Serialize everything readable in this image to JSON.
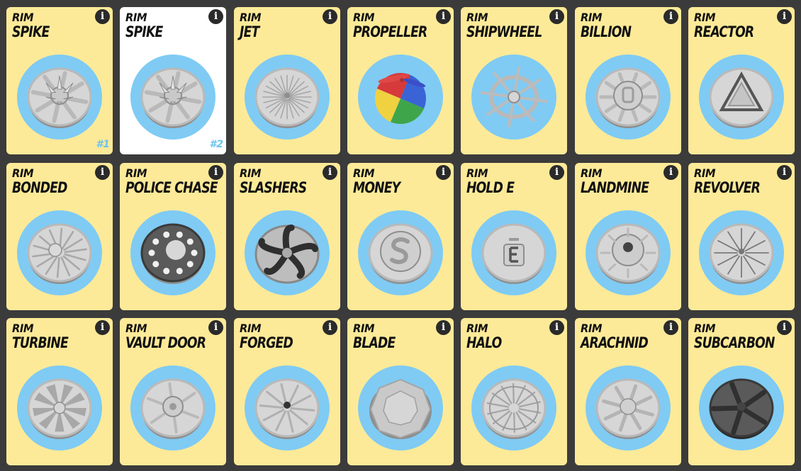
{
  "info_glyph": "i",
  "cards": [
    {
      "type": "RIM",
      "name": "SPIKE",
      "badge": "#1",
      "icon": "spike-rim-icon",
      "style": "spike",
      "selected": false
    },
    {
      "type": "RIM",
      "name": "SPIKE",
      "badge": "#2",
      "icon": "spike-rim-icon",
      "style": "spike",
      "selected": true
    },
    {
      "type": "RIM",
      "name": "JET",
      "badge": "",
      "icon": "jet-rim-icon",
      "style": "jet",
      "selected": false
    },
    {
      "type": "RIM",
      "name": "PROPELLER",
      "badge": "",
      "icon": "propeller-cap-icon",
      "style": "propeller",
      "selected": false
    },
    {
      "type": "RIM",
      "name": "SHIPWHEEL",
      "badge": "",
      "icon": "shipwheel-rim-icon",
      "style": "shipwheel",
      "selected": false
    },
    {
      "type": "RIM",
      "name": "BILLION",
      "badge": "",
      "icon": "billion-rim-icon",
      "style": "billion",
      "selected": false
    },
    {
      "type": "RIM",
      "name": "REACTOR",
      "badge": "",
      "icon": "reactor-rim-icon",
      "style": "reactor",
      "selected": false
    },
    {
      "type": "RIM",
      "name": "BONDED",
      "badge": "",
      "icon": "bonded-rim-icon",
      "style": "bonded",
      "selected": false
    },
    {
      "type": "RIM",
      "name": "POLICE CHASE",
      "badge": "",
      "icon": "police-chase-rim-icon",
      "style": "police",
      "selected": false
    },
    {
      "type": "RIM",
      "name": "SLASHERS",
      "badge": "",
      "icon": "slashers-rim-icon",
      "style": "slashers",
      "selected": false
    },
    {
      "type": "RIM",
      "name": "MONEY",
      "badge": "",
      "icon": "money-rim-icon",
      "style": "money",
      "selected": false
    },
    {
      "type": "RIM",
      "name": "HOLD E",
      "badge": "",
      "icon": "hold-e-rim-icon",
      "style": "holde",
      "selected": false
    },
    {
      "type": "RIM",
      "name": "LANDMINE",
      "badge": "",
      "icon": "landmine-rim-icon",
      "style": "landmine",
      "selected": false
    },
    {
      "type": "RIM",
      "name": "REVOLVER",
      "badge": "",
      "icon": "revolver-rim-icon",
      "style": "revolver",
      "selected": false
    },
    {
      "type": "RIM",
      "name": "TURBINE",
      "badge": "",
      "icon": "turbine-rim-icon",
      "style": "turbine",
      "selected": false
    },
    {
      "type": "RIM",
      "name": "VAULT DOOR",
      "badge": "",
      "icon": "vault-door-rim-icon",
      "style": "vault",
      "selected": false
    },
    {
      "type": "RIM",
      "name": "FORGED",
      "badge": "",
      "icon": "forged-rim-icon",
      "style": "forged",
      "selected": false
    },
    {
      "type": "RIM",
      "name": "BLADE",
      "badge": "",
      "icon": "blade-rim-icon",
      "style": "blade",
      "selected": false
    },
    {
      "type": "RIM",
      "name": "HALO",
      "badge": "",
      "icon": "halo-rim-icon",
      "style": "halo",
      "selected": false
    },
    {
      "type": "RIM",
      "name": "ARACHNID",
      "badge": "",
      "icon": "arachnid-rim-icon",
      "style": "arachnid",
      "selected": false
    },
    {
      "type": "RIM",
      "name": "SUBCARBON",
      "badge": "",
      "icon": "subcarbon-rim-icon",
      "style": "subcarbon",
      "selected": false
    }
  ],
  "colors": {
    "card": "#fdea98",
    "card_selected": "#ffffff",
    "circle": "#7fcbf4",
    "badge": "#6cc3ef",
    "background": "#3b3b3b"
  }
}
